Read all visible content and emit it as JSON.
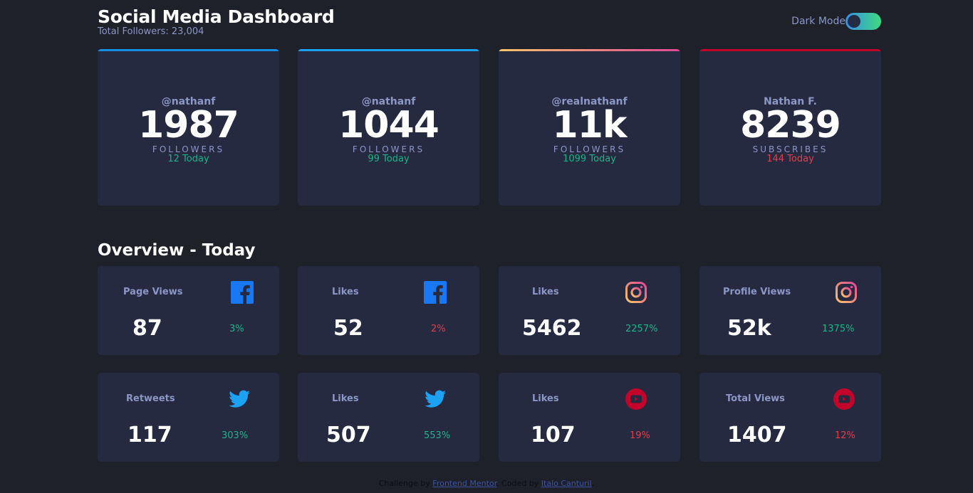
{
  "header": {
    "title": "Social Media Dashboard",
    "total_followers": "Total Followers: 23,004",
    "toggle_label": "Dark Mode"
  },
  "cards": [
    {
      "network": "facebook",
      "handle": "@nathanf",
      "count": "1987",
      "unit": "FOLLOWERS",
      "today": "12 Today",
      "trend": "up",
      "accent": "#178fe6"
    },
    {
      "network": "twitter",
      "handle": "@nathanf",
      "count": "1044",
      "unit": "FOLLOWERS",
      "today": "99 Today",
      "trend": "up",
      "accent": "#1ca0f2"
    },
    {
      "network": "instagram",
      "handle": "@realnathanf",
      "count": "11k",
      "unit": "FOLLOWERS",
      "today": "1099 Today",
      "trend": "up",
      "accent": "#df4995"
    },
    {
      "network": "youtube",
      "handle": "Nathan F.",
      "count": "8239",
      "unit": "SUBSCRIBES",
      "today": "144 Today",
      "trend": "down",
      "accent": "#c4032a"
    }
  ],
  "overview": {
    "title": "Overview - Today",
    "items": [
      {
        "label": "Page Views",
        "icon": "facebook-icon",
        "value": "87",
        "pct": "3%",
        "trend": "up"
      },
      {
        "label": "Likes",
        "icon": "facebook-icon",
        "value": "52",
        "pct": "2%",
        "trend": "down"
      },
      {
        "label": "Likes",
        "icon": "instagram-icon",
        "value": "5462",
        "pct": "2257%",
        "trend": "up"
      },
      {
        "label": "Profile Views",
        "icon": "instagram-icon",
        "value": "52k",
        "pct": "1375%",
        "trend": "up"
      },
      {
        "label": "Retweets",
        "icon": "twitter-icon",
        "value": "117",
        "pct": "303%",
        "trend": "up"
      },
      {
        "label": "Likes",
        "icon": "twitter-icon",
        "value": "507",
        "pct": "553%",
        "trend": "up"
      },
      {
        "label": "Likes",
        "icon": "youtube-icon",
        "value": "107",
        "pct": "19%",
        "trend": "down"
      },
      {
        "label": "Total Views",
        "icon": "youtube-icon",
        "value": "1407",
        "pct": "12%",
        "trend": "down"
      }
    ]
  },
  "footer": {
    "challenge_by": "Challenge by",
    "challenge_link": "Frontend Mentor",
    "coded_by": "Coded by",
    "author_link": "Italo Canturil"
  },
  "colors": {
    "background": "#1e202a",
    "card": "#252a41",
    "up": "#1db489",
    "down": "#dc414c",
    "muted": "#8b97c6"
  }
}
